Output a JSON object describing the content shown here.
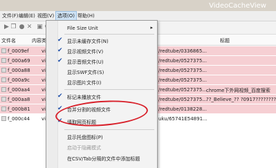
{
  "window": {
    "title": "VideoCacheView"
  },
  "menubar": [
    {
      "label": "文件(F)"
    },
    {
      "label": "编辑(E)"
    },
    {
      "label": "视图(V)"
    },
    {
      "label": "选项(O)"
    },
    {
      "label": "帮助(H)"
    }
  ],
  "toolbar": {
    "icons": [
      "play-icon",
      "copy-icon",
      "stop-icon",
      "delete-icon",
      "save-icon",
      "refresh-icon"
    ]
  },
  "columns": {
    "filename": "文件名",
    "content_type": "内容类",
    "title": "标题"
  },
  "rows": [
    {
      "name": "f_0009ef",
      "type": "video",
      "url": "/redtube/0336865...",
      "title": "",
      "highlight": true
    },
    {
      "name": "f_000a69",
      "type": "video",
      "url": "/redtube/0527375...",
      "title": "",
      "highlight": true
    },
    {
      "name": "f_000a88",
      "type": "video",
      "url": "/redtube/0527375...",
      "title": "",
      "highlight": true
    },
    {
      "name": "f_000a9c",
      "type": "video",
      "url": "/redtube/0527375...",
      "title": "",
      "highlight": true
    },
    {
      "name": "f_000aa4",
      "type": "video",
      "url": "/redtube/0527375...",
      "title": "chrome下外网视频_百度搜索",
      "highlight": true
    },
    {
      "name": "f_000aa8",
      "type": "video",
      "url": "/redtube/0527375...",
      "title": "??_Believe_?? ?0917??????????",
      "highlight": true
    },
    {
      "name": "f_000b81",
      "type": "video",
      "url": "/redtube/0138228...",
      "title": "",
      "highlight": true
    },
    {
      "name": "f_000c44",
      "type": "video",
      "url": "uku/65741E54891...",
      "title": "",
      "highlight": false
    }
  ],
  "menu": {
    "items": [
      {
        "label": "File Size Unit",
        "checked": false,
        "disabled": false,
        "submenu": true
      },
      {
        "label": "显示未缓存文件(N)",
        "checked": true,
        "disabled": false
      },
      {
        "label": "显示视频文件(V)",
        "checked": true,
        "disabled": false
      },
      {
        "label": "显示音频文件(U)",
        "checked": true,
        "disabled": false
      },
      {
        "label": "显示SWF文件(S)",
        "checked": false,
        "disabled": false
      },
      {
        "label": "显示图片文件(I)",
        "checked": false,
        "disabled": false
      },
      {
        "label": "标记未播放文件",
        "checked": true,
        "disabled": false
      },
      {
        "label": "合并分割的视频文件",
        "checked": true,
        "disabled": false
      },
      {
        "label": "填取网页标题",
        "checked": true,
        "disabled": false
      },
      {
        "label": "显示托盘图标(P)",
        "checked": false,
        "disabled": false
      },
      {
        "label": "启动于隐藏模式",
        "checked": false,
        "disabled": true
      },
      {
        "label": "在CSV/Tab分隔的文件中添加标题",
        "checked": false,
        "disabled": false
      }
    ],
    "check_mark": "✔",
    "submenu_arrow": "▸"
  },
  "colors": {
    "highlight_row": "#f6cfd3",
    "annotation": "#d8202a",
    "check": "#1f4fa8"
  }
}
